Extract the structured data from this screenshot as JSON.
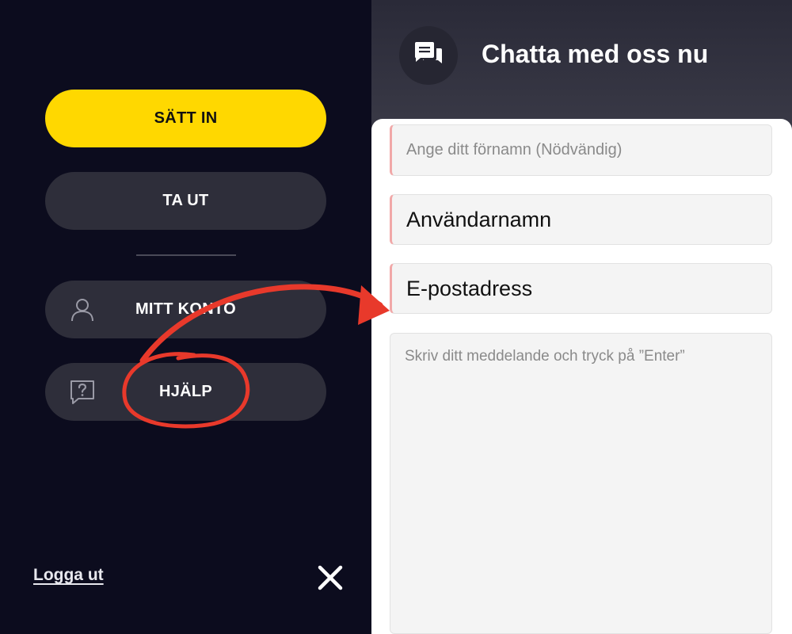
{
  "menu": {
    "deposit_label": "SÄTT IN",
    "withdraw_label": "TA UT",
    "account_label": "MITT KONTO",
    "help_label": "HJÄLP",
    "logout_label": "Logga ut",
    "account_icon": "user-icon",
    "help_icon": "question-bubble-icon",
    "close_icon": "close-icon"
  },
  "chat": {
    "title": "Chatta med oss nu",
    "header_icon": "chat-bubbles-icon",
    "name_placeholder": "Ange ditt förnamn (Nödvändig)",
    "username_value": "Användarnamn",
    "email_value": "E-postadress",
    "message_placeholder": "Skriv ditt meddelande och tryck på ”Enter”"
  },
  "colors": {
    "background": "#0c0c1e",
    "deposit_button": "#ffd800",
    "menu_button": "#2e2e3a",
    "annotation_red": "#e8392b",
    "field_accent": "#f1a8a8"
  }
}
